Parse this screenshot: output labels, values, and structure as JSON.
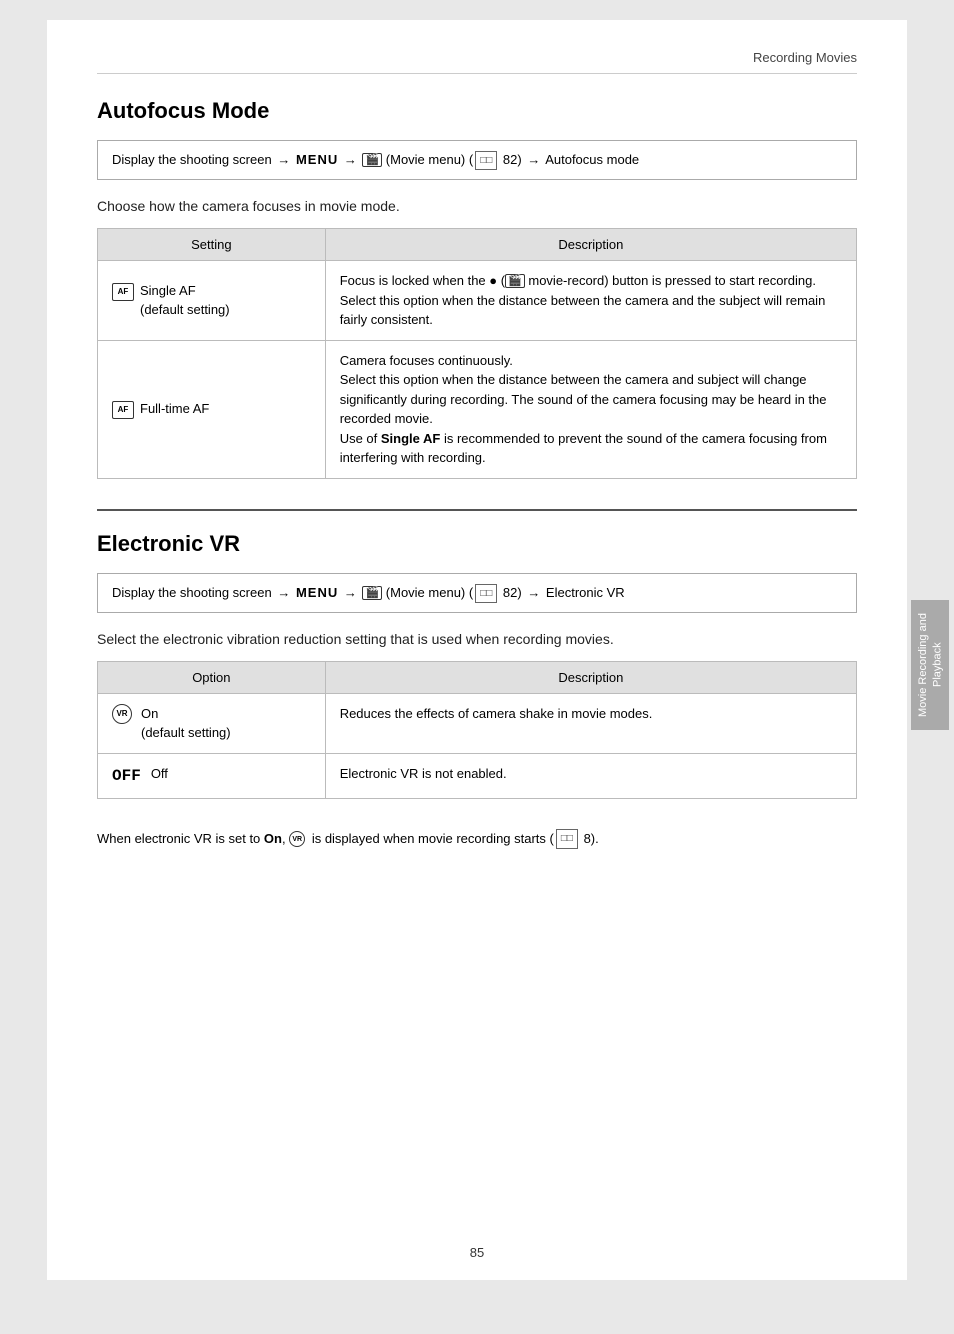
{
  "header": {
    "title": "Recording Movies"
  },
  "autofocus_section": {
    "title": "Autofocus Mode",
    "nav_instruction": "Display the shooting screen → MENU → ",
    "nav_movie_menu": "🎬",
    "nav_suffix": " (Movie menu) (□□ 82) → Autofocus mode",
    "intro": "Choose how the camera focuses in movie mode.",
    "table": {
      "col1_header": "Setting",
      "col2_header": "Description",
      "rows": [
        {
          "icon": "AF",
          "label": "Single AF\n(default setting)",
          "description": "Focus is locked when the ● (movie-record) button is pressed to start recording.\nSelect this option when the distance between the camera and the subject will remain fairly consistent."
        },
        {
          "icon": "AF",
          "label": "Full-time AF",
          "description": "Camera focuses continuously.\nSelect this option when the distance between the camera and subject will change significantly during recording. The sound of the camera focusing may be heard in the recorded movie.\nUse of Single AF is recommended to prevent the sound of the camera focusing from interfering with recording."
        }
      ]
    }
  },
  "electronic_vr_section": {
    "title": "Electronic VR",
    "nav_instruction": "Display the shooting screen → MENU → ",
    "nav_suffix": " (Movie menu) (□□ 82) → Electronic VR",
    "intro": "Select the electronic vibration reduction setting that is used when recording movies.",
    "table": {
      "col1_header": "Option",
      "col2_header": "Description",
      "rows": [
        {
          "icon": "VR_ON",
          "label": "On\n(default setting)",
          "description": "Reduces the effects of camera shake in movie modes."
        },
        {
          "icon": "OFF",
          "label": "Off",
          "description": "Electronic VR is not enabled."
        }
      ]
    },
    "bottom_note": "When electronic VR is set to On, the VR icon is displayed when movie recording starts (□□ 8)."
  },
  "sidebar": {
    "label": "Movie Recording and Playback"
  },
  "page_number": "85"
}
